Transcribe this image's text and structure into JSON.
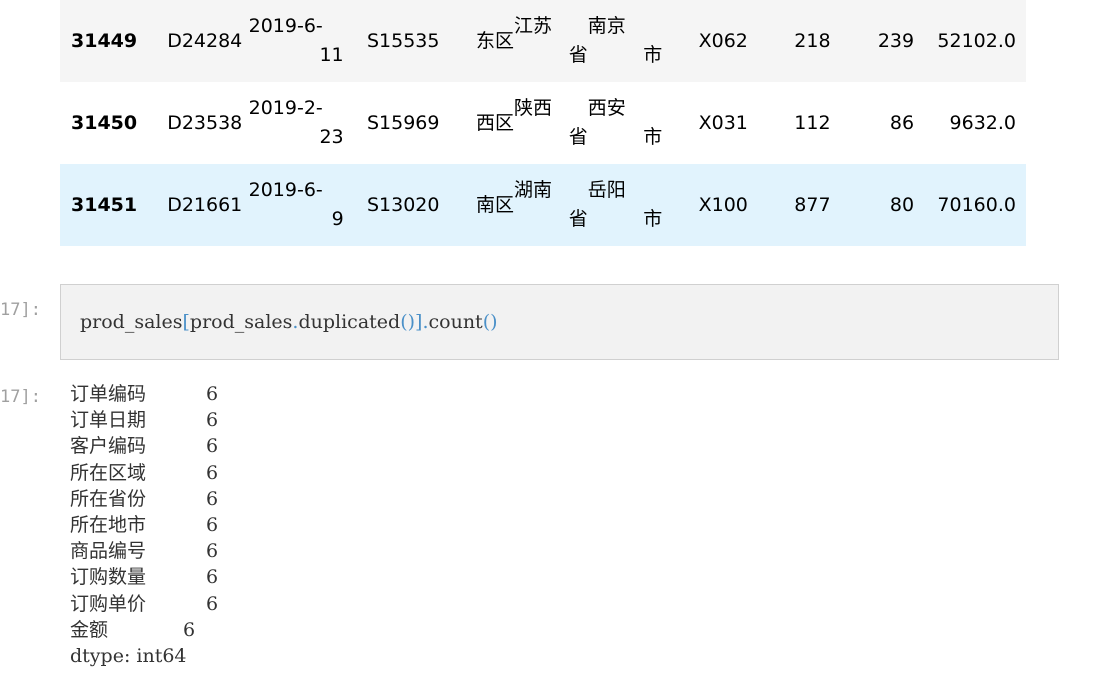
{
  "table": {
    "rows": [
      {
        "index": "31449",
        "order_code": "D24284",
        "date_l1": "2019-6-",
        "date_l2": "11",
        "customer": "S15535",
        "region": "东区",
        "province_l1": "江苏",
        "province_l2": "省",
        "city_l1": "南京",
        "city_l2": "市",
        "product": "X062",
        "quantity": "218",
        "price": "239",
        "amount": "52102.0"
      },
      {
        "index": "31450",
        "order_code": "D23538",
        "date_l1": "2019-2-",
        "date_l2": "23",
        "customer": "S15969",
        "region": "西区",
        "province_l1": "陕西",
        "province_l2": "省",
        "city_l1": "西安",
        "city_l2": "市",
        "product": "X031",
        "quantity": "112",
        "price": "86",
        "amount": "9632.0"
      },
      {
        "index": "31451",
        "order_code": "D21661",
        "date_l1": "2019-6-",
        "date_l2": "9",
        "customer": "S13020",
        "region": "南区",
        "province_l1": "湖南",
        "province_l2": "省",
        "city_l1": "岳阳",
        "city_l2": "市",
        "product": "X100",
        "quantity": "877",
        "price": "80",
        "amount": "70160.0"
      }
    ]
  },
  "cell": {
    "in_prompt": "17]:",
    "out_prompt": "17]:",
    "code": {
      "part1": "prod_sales",
      "bracket_open": "[",
      "part2": "prod_sales",
      "dot1": ".",
      "part3": "duplicated",
      "parens1": "()",
      "bracket_close": "]",
      "dot2": ".",
      "part4": "count",
      "parens2": "()"
    }
  },
  "output": {
    "rows": [
      {
        "key": "订单编码",
        "value": "6"
      },
      {
        "key": "订单日期",
        "value": "6"
      },
      {
        "key": "客户编码",
        "value": "6"
      },
      {
        "key": "所在区域",
        "value": "6"
      },
      {
        "key": "所在省份",
        "value": "6"
      },
      {
        "key": "所在地市",
        "value": "6"
      },
      {
        "key": "商品编号",
        "value": "6"
      },
      {
        "key": "订购数量",
        "value": "6"
      },
      {
        "key": "订购单价",
        "value": "6"
      },
      {
        "key": "金额",
        "value": "6"
      }
    ],
    "dtype": "dtype: int64"
  }
}
